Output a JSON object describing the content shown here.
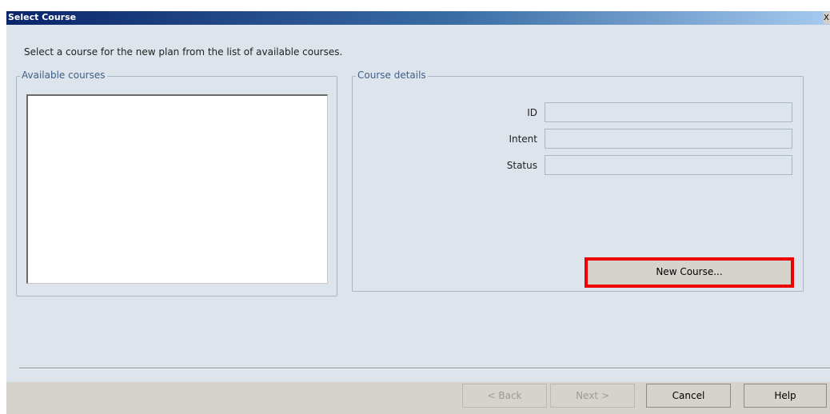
{
  "window": {
    "title": "Select Course",
    "close_glyph": "X"
  },
  "instruction": "Select a course for the new plan from the list of available courses.",
  "available_courses": {
    "legend": "Available courses",
    "items": []
  },
  "course_details": {
    "legend": "Course details",
    "fields": [
      {
        "label": "ID",
        "value": ""
      },
      {
        "label": "Intent",
        "value": ""
      },
      {
        "label": "Status",
        "value": ""
      }
    ],
    "new_course_button": "New Course..."
  },
  "footer": {
    "back": "< Back",
    "next": "Next >",
    "cancel": "Cancel",
    "help": "Help"
  },
  "colors": {
    "highlight": "#ee0000",
    "titlebar": "#0a246a",
    "background": "#dde4ec"
  }
}
